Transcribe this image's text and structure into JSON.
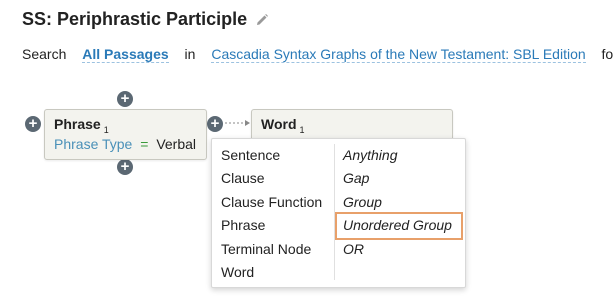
{
  "header": {
    "title": "SS: Periphrastic Participle"
  },
  "search_line": {
    "search_label": "Search",
    "passages_link": "All Passages",
    "in_label": "in",
    "resource_link": "Cascadia Syntax Graphs of the New Testament: SBL Edition",
    "for_label": "for"
  },
  "graph": {
    "phrase_node": {
      "title": "Phrase",
      "index": "1",
      "attr_key": "Phrase Type",
      "attr_op": "=",
      "attr_value": "Verbal"
    },
    "word_node": {
      "title": "Word",
      "index": "1"
    },
    "add_symbol": "+"
  },
  "menu": {
    "left_items": [
      "Sentence",
      "Clause",
      "Clause Function",
      "Phrase",
      "Terminal Node",
      "Word"
    ],
    "right_items": [
      "Anything",
      "Gap",
      "Group",
      "Unordered Group",
      "OR"
    ],
    "selected": "Unordered Group",
    "highlight_color": "#e8a06a"
  },
  "colors": {
    "link": "#2a7ab8",
    "attr_key": "#4a90b8",
    "operator": "#3a9a3a",
    "node_bg": "#f3f3ee",
    "plus_bg": "#5b6873"
  }
}
